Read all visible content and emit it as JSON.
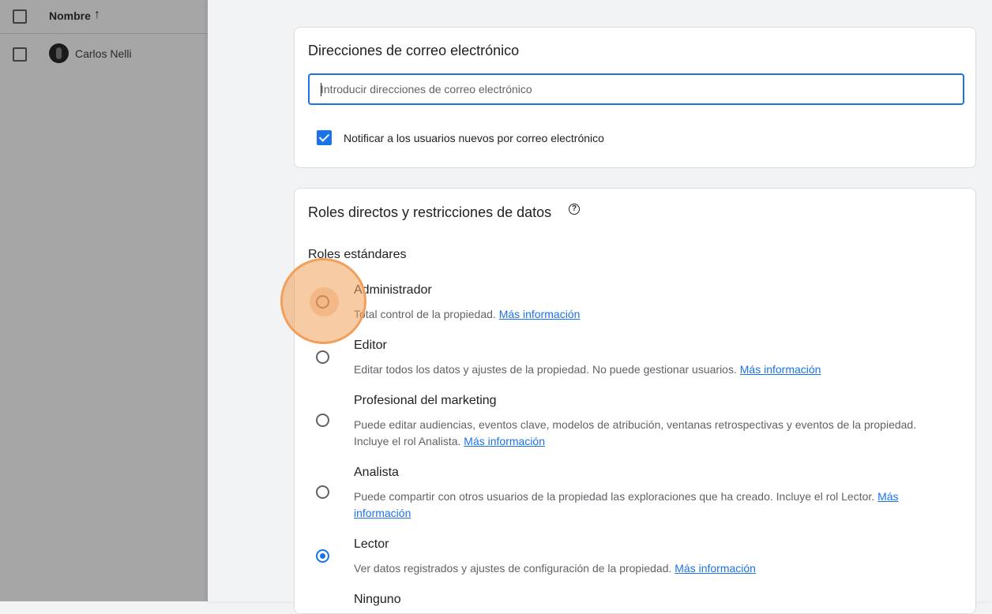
{
  "background_list": {
    "header_label": "Nombre",
    "sort_icon": "arrow-up-icon",
    "rows": [
      {
        "name": "Carlos Nelli"
      }
    ]
  },
  "email_card": {
    "title": "Direcciones de correo electrónico",
    "input_placeholder": "Introducir direcciones de correo electrónico",
    "input_value": "",
    "notify_label": "Notificar a los usuarios nuevos por correo electrónico",
    "notify_checked": true
  },
  "roles_card": {
    "title": "Roles directos y restricciones de datos",
    "standard_roles_label": "Roles estándares",
    "link_text": "Más información",
    "roles": [
      {
        "name": "Administrador",
        "desc": "Total control de la propiedad.",
        "link": "Más información",
        "selected": false
      },
      {
        "name": "Editor",
        "desc": "Editar todos los datos y ajustes de la propiedad. No puede gestionar usuarios.",
        "link": "Más información",
        "selected": false
      },
      {
        "name": "Profesional del marketing",
        "desc": "Puede editar audiencias, eventos clave, modelos de atribución, ventanas retrospectivas y eventos de la propiedad. Incluye el rol Analista.",
        "link": "Más información",
        "selected": false
      },
      {
        "name": "Analista",
        "desc": "Puede compartir con otros usuarios de la propiedad las exploraciones que ha creado. Incluye el rol Lector.",
        "link": "Más información",
        "selected": false
      },
      {
        "name": "Lector",
        "desc": "Ver datos registrados y ajustes de configuración de la propiedad.",
        "link": "Más información",
        "selected": true
      },
      {
        "name": "Ninguno",
        "desc": "",
        "link": "",
        "selected": false
      }
    ]
  },
  "colors": {
    "accent": "#1a73e8",
    "click_highlight": "#f0a05a"
  }
}
